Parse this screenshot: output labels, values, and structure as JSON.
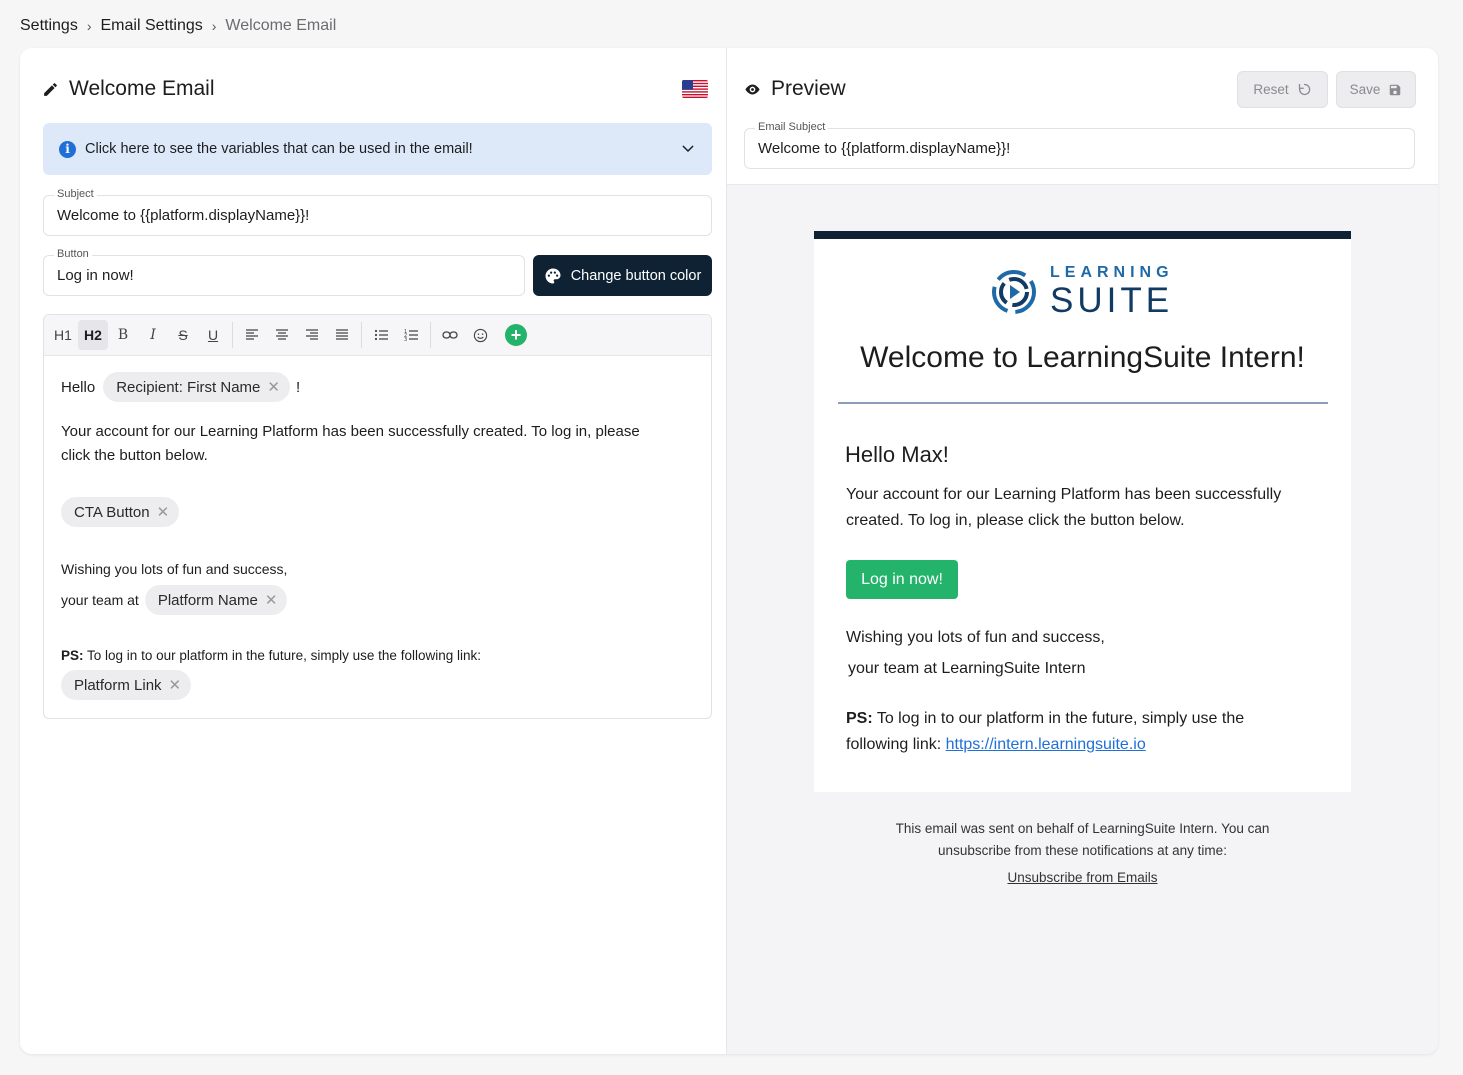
{
  "breadcrumb": {
    "items": [
      "Settings",
      "Email Settings",
      "Welcome Email"
    ]
  },
  "editor_panel": {
    "title": "Welcome Email",
    "info_text": "Click here to see the variables that can be used in the email!",
    "subject_label": "Subject",
    "subject_value": "Welcome to {{platform.displayName}}!",
    "button_label": "Button",
    "button_value": "Log in now!",
    "change_color_label": "Change button color",
    "toolbar": {
      "h1": "H1",
      "h2": "H2",
      "bold": "B",
      "italic": "I",
      "strike": "S",
      "underline": "U"
    },
    "body": {
      "hello": "Hello",
      "recipient_chip": "Recipient: First Name",
      "exclaim": "!",
      "para1_line1": "Your account for our Learning Platform has been successfully created. To log in, please",
      "para1_line2": "click the button below.",
      "cta_chip": "CTA Button",
      "wish": "Wishing you lots of fun and success,",
      "team_at": "your team at",
      "platform_name_chip": "Platform Name",
      "ps_label": "PS:",
      "ps_text": "To log in to our platform in the future, simply use the following link:",
      "platform_link_chip": "Platform Link"
    }
  },
  "preview_panel": {
    "title": "Preview",
    "reset_label": "Reset",
    "save_label": "Save",
    "email_subject_label": "Email Subject",
    "email_subject_value": "Welcome to {{platform.displayName}}!",
    "email": {
      "logo_line1": "LEARNING",
      "logo_line2": "SUITE",
      "title": "Welcome to LearningSuite Intern!",
      "hello": "Hello Max!",
      "para1_line1": "Your account for our Learning Platform has been successfully",
      "para1_line2": "created. To log in, please click the button below.",
      "button": "Log in now!",
      "wish": "Wishing you lots of fun and success,",
      "team": "your team at LearningSuite Intern",
      "ps_label": "PS:",
      "ps_line1": "To log in to our platform in the future, simply use the",
      "ps_line2": "following link:",
      "ps_link": "https://intern.learningsuite.io"
    },
    "footer_line1": "This email was sent on behalf of LearningSuite Intern. You can",
    "footer_line2": "unsubscribe from these notifications at any time:",
    "unsubscribe": "Unsubscribe from Emails"
  },
  "colors": {
    "dark_navy": "#0e2233",
    "green": "#23b36b",
    "info_bg": "#dde9f9",
    "link_blue": "#1f6fd6"
  },
  "icons": [
    "pencil-icon",
    "us-flag-icon",
    "info-icon",
    "chevron-down-icon",
    "palette-icon",
    "eye-icon",
    "reset-icon",
    "save-icon",
    "plus-icon"
  ]
}
